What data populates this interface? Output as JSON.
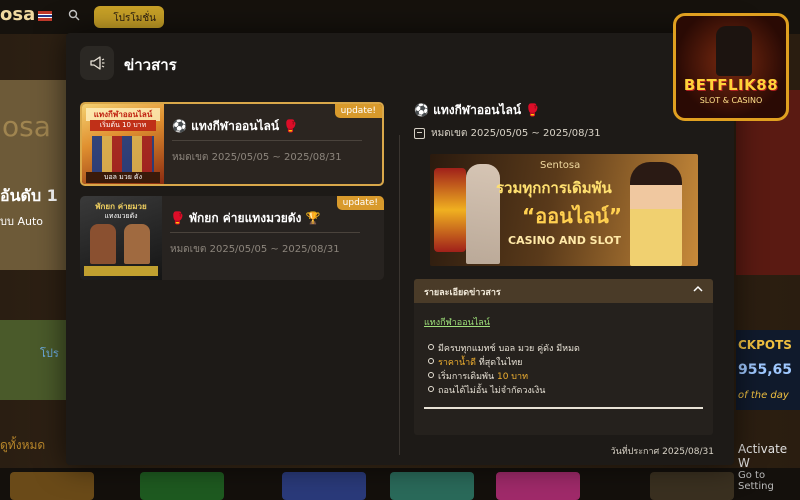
{
  "background": {
    "logo_text": "osa",
    "promo_label": "โปรโมชั่น",
    "hero_text_1": "osa",
    "hero_text_2": "อันดับ 1",
    "hero_text_3": "บบ Auto",
    "left_banner_text": "โปร",
    "left_link_text": "ดูทั้งหมด",
    "jackpot_title": "CKPOTS",
    "jackpot_value": "955,65",
    "jackpot_sub": "of the day",
    "activate_title": "Activate W",
    "activate_sub": "Go to Setting"
  },
  "brand": {
    "wordmark": "BETFLIK88",
    "sub": "SLOT & CASINO"
  },
  "modal": {
    "title": "ข่าวสาร",
    "news": [
      {
        "title": "⚽ แทงกีฬาออนไลน์ 🥊",
        "badge": "update!",
        "date": "หมดเขต 2025/05/05 ~ 2025/08/31",
        "thumb_text_1": "แทงกีฬาออนไลน์",
        "thumb_text_2": "เริ่มต้น 10 บาท",
        "thumb_text_3": "บอล มวย ดัง"
      },
      {
        "title": "🥊 พักยก ค่ายแทงมวยดัง 🏆",
        "badge": "update!",
        "date": "หมดเขต 2025/05/05 ~ 2025/08/31",
        "thumb_text_1": "พักยก ค่ายมวย",
        "thumb_text_2": "แทงมวยดัง"
      }
    ],
    "detail": {
      "title": "⚽ แทงกีฬาออนไลน์ 🥊",
      "date": "หมดเขต 2025/05/05 ~ 2025/08/31",
      "banner_logo": "Sentosa",
      "banner_line_1": "รวมทุกการเดิมพัน",
      "banner_line_2": "“ออนไลน์”",
      "banner_line_3": "CASINO AND SLOT",
      "accordion_title": "รายละเอียดข่าวสาร",
      "accordion_chevron": "^",
      "link_text": "แทงกีฬาออนไลน์",
      "bullets": [
        {
          "pre": "มีครบทุกแมทช์ บอล มวย คู่ดัง มีหมด",
          "hl": ""
        },
        {
          "pre": "",
          "hl": "ราคาน้ำดี",
          "post": " ที่สุดในไทย"
        },
        {
          "pre": "เริ่มการเดิมพัน ",
          "hl": "10 บาท"
        },
        {
          "pre": "ถอนได้ไม่อั้น ไม่จำกัดวงเงิน",
          "hl": ""
        }
      ],
      "footer": "วันที่ประกาศ 2025/08/31"
    }
  }
}
